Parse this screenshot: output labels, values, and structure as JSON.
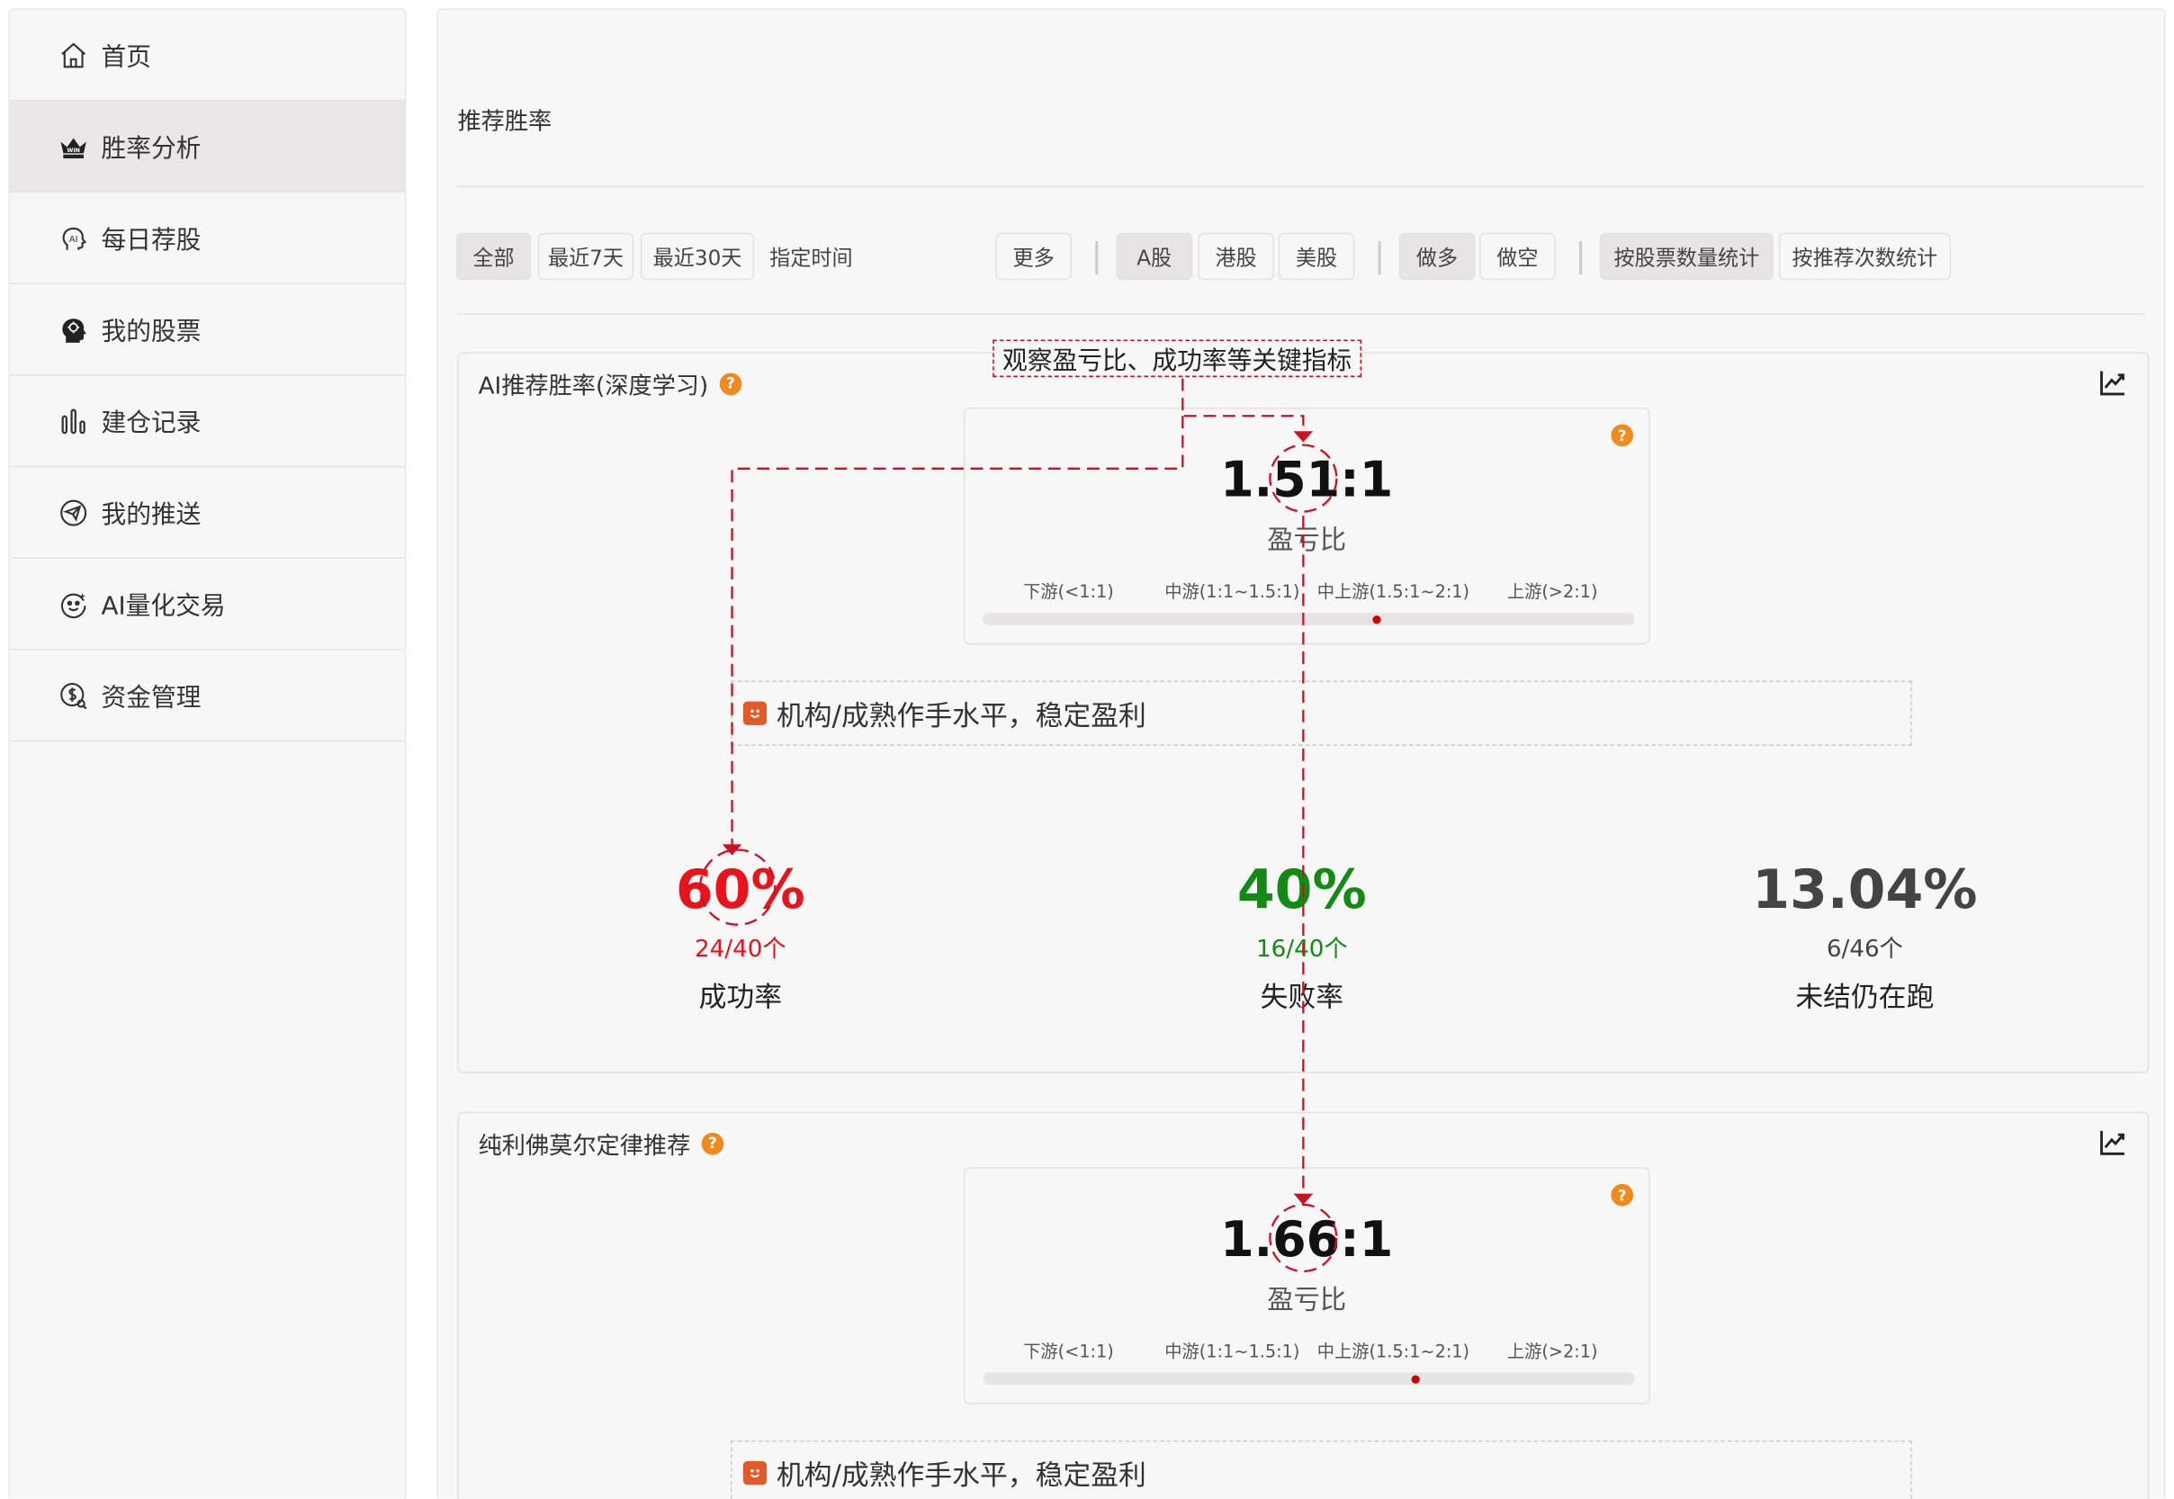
{
  "sidebar": {
    "items": [
      {
        "label": "首页",
        "icon": "home-icon"
      },
      {
        "label": "胜率分析",
        "icon": "crown-icon"
      },
      {
        "label": "每日荐股",
        "icon": "ai-head-icon"
      },
      {
        "label": "我的股票",
        "icon": "brain-head-icon"
      },
      {
        "label": "建仓记录",
        "icon": "bar-chart-icon"
      },
      {
        "label": "我的推送",
        "icon": "push-icon"
      },
      {
        "label": "AI量化交易",
        "icon": "robot-face-icon"
      },
      {
        "label": "资金管理",
        "icon": "money-search-icon"
      }
    ],
    "active_index": 1
  },
  "page": {
    "title": "推荐胜率"
  },
  "filters": {
    "time": [
      "全部",
      "最近7天",
      "最近30天"
    ],
    "custom_time": "指定时间",
    "more": "更多",
    "market": [
      "A股",
      "港股",
      "美股"
    ],
    "direction": [
      "做多",
      "做空"
    ],
    "stat_mode": [
      "按股票数量统计",
      "按推荐次数统计"
    ],
    "selected": [
      "全部",
      "A股",
      "做多",
      "按股票数量统计"
    ]
  },
  "annotation": {
    "label": "观察盈亏比、成功率等关键指标",
    "color": "#cc1122"
  },
  "scale_labels": [
    "下游(<1:1)",
    "中游(1:1~1.5:1)",
    "中上游(1.5:1~2:1)",
    "上游(>2:1)"
  ],
  "cards": [
    {
      "title": "AI推荐胜率(深度学习)",
      "ratio": "1.51:1",
      "ratio_label": "盈亏比",
      "ratio_value": 1.51,
      "note": "机构/成熟作手水平，稳定盈利",
      "stats": [
        {
          "big": "60%",
          "sub": "24/40个",
          "label": "成功率",
          "color": "#e8141b"
        },
        {
          "big": "40%",
          "sub": "16/40个",
          "label": "失败率",
          "color": "#138a13"
        },
        {
          "big": "13.04%",
          "sub": "6/46个",
          "label": "未结仍在跑",
          "color": "#444444"
        }
      ]
    },
    {
      "title": "纯利佛莫尔定律推荐",
      "ratio": "1.66:1",
      "ratio_label": "盈亏比",
      "ratio_value": 1.66,
      "note": "机构/成熟作手水平，稳定盈利"
    }
  ]
}
